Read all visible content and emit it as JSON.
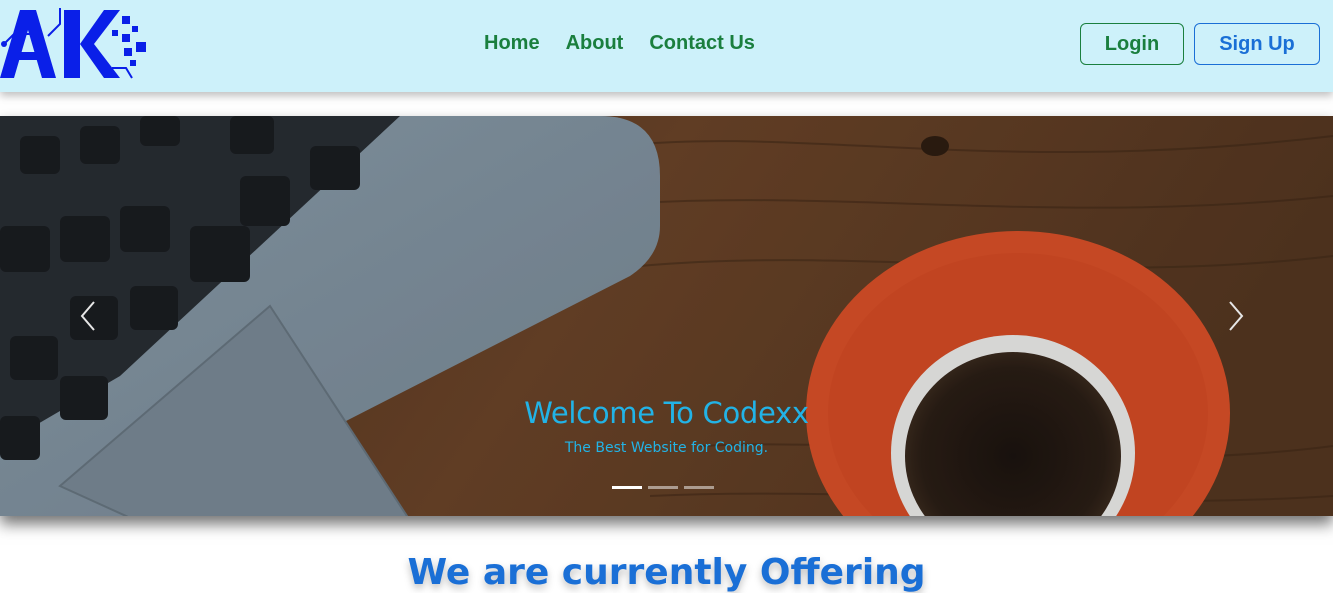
{
  "brand": {
    "logo_text": "AK",
    "logo_icon": "circuit-logo-icon",
    "color": "#0a1fe8"
  },
  "nav": {
    "links": [
      {
        "label": "Home"
      },
      {
        "label": "About"
      },
      {
        "label": "Contact Us"
      }
    ],
    "link_color": "#1a7f3e",
    "background": "#cdf1fa"
  },
  "auth": {
    "login_label": "Login",
    "signup_label": "Sign Up"
  },
  "carousel": {
    "prev_icon": "chevron-left-icon",
    "next_icon": "chevron-right-icon",
    "caption_title": "Welcome To Codexx",
    "caption_subtitle": "The Best Website for Coding.",
    "slide_count": 3,
    "active_slide": 1,
    "caption_color": "#22b3e6"
  },
  "section": {
    "heading": "We are currently Offering",
    "color": "#1a6fd6"
  }
}
